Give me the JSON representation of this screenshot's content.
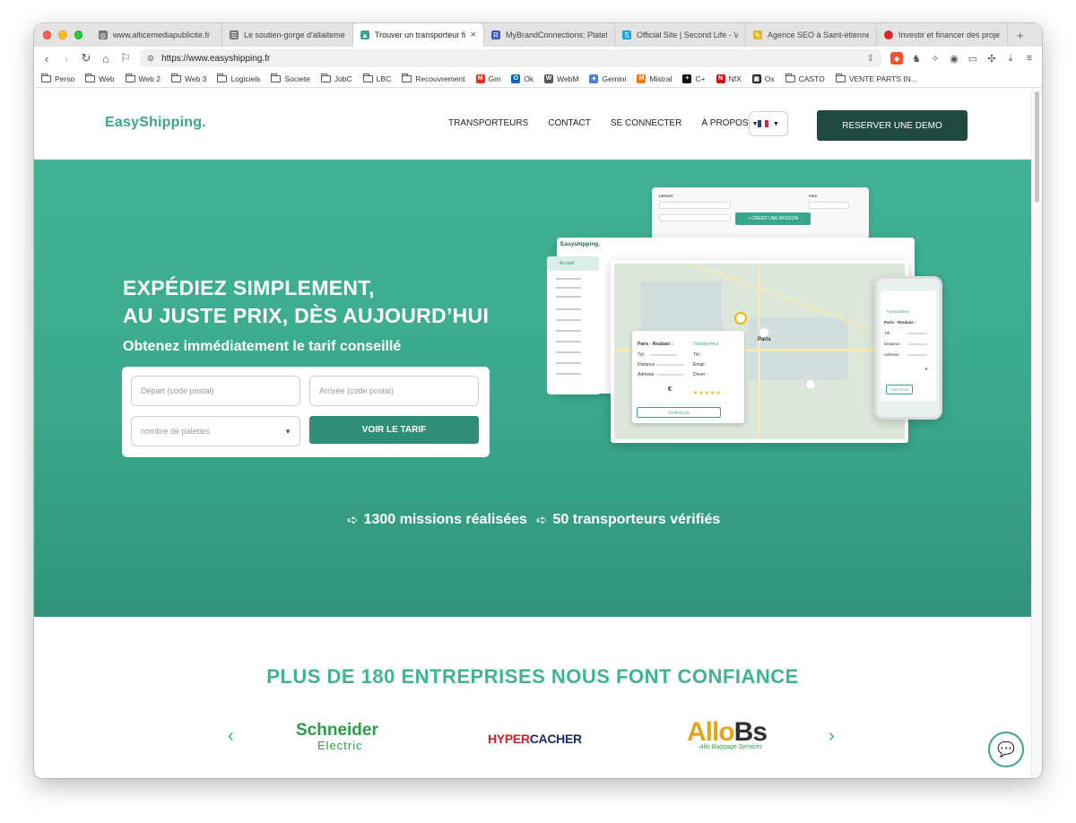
{
  "tabs": [
    {
      "title": "www.alticemediapublicite.fr",
      "icon_color": "#777777",
      "icon": "globe-icon",
      "active": false
    },
    {
      "title": "Le soutien-gorge d'allaitement",
      "icon_color": "#777777",
      "icon": "page-icon",
      "active": false
    },
    {
      "title": "Trouver un transporteur fi",
      "icon_color": "#3aa58d",
      "icon": "easyshipping-icon",
      "active": true
    },
    {
      "title": "MyBrandConnections: Platefo",
      "icon_color": "#3b5bc0",
      "icon": "rr-icon",
      "active": false
    },
    {
      "title": "Official Site | Second Life - Vi",
      "icon_color": "#19a3d9",
      "icon": "secondlife-icon",
      "active": false
    },
    {
      "title": "Agence SEO à Saint-étienne",
      "icon_color": "#e8b526",
      "icon": "seo-icon",
      "active": false
    },
    {
      "title": "Investir et financer des proje",
      "icon_color": "#d62828",
      "icon": "invest-icon",
      "active": false
    }
  ],
  "url": "https://www.easyshipping.fr",
  "bookmarks": [
    {
      "label": "Perso",
      "type": "folder"
    },
    {
      "label": "Web",
      "type": "folder"
    },
    {
      "label": "Web 2",
      "type": "folder"
    },
    {
      "label": "Web 3",
      "type": "folder"
    },
    {
      "label": "Logiciels",
      "type": "folder"
    },
    {
      "label": "Societe",
      "type": "folder"
    },
    {
      "label": "JobC",
      "type": "folder"
    },
    {
      "label": "LBC",
      "type": "folder"
    },
    {
      "label": "Recouvrement",
      "type": "folder"
    },
    {
      "label": "Gm",
      "type": "icon",
      "color": "#d93025",
      "glyph": "M"
    },
    {
      "label": "Ok",
      "type": "icon",
      "color": "#0a66c2",
      "glyph": "O"
    },
    {
      "label": "WebM",
      "type": "icon",
      "color": "#555555",
      "glyph": "W"
    },
    {
      "label": "Gemini",
      "type": "icon",
      "color": "#4a7bd8",
      "glyph": "✦"
    },
    {
      "label": "Mistral",
      "type": "icon",
      "color": "#f07a16",
      "glyph": "M"
    },
    {
      "label": "C+",
      "type": "icon",
      "color": "#111111",
      "glyph": "+"
    },
    {
      "label": "NfX",
      "type": "icon",
      "color": "#d80f16",
      "glyph": "N"
    },
    {
      "label": "Ox",
      "type": "icon",
      "color": "#222222",
      "glyph": "▣"
    },
    {
      "label": "CASTO",
      "type": "folder"
    },
    {
      "label": "VENTE PARTS IN...",
      "type": "folder"
    }
  ],
  "site": {
    "logo": "EasyShipping.",
    "nav": [
      "TRANSPORTEURS",
      "CONTACT",
      "SE CONNECTER",
      "À PROPOS"
    ],
    "demo_button": "RESERVER UNE DEMO",
    "hero_line1": "EXPÉDIEZ SIMPLEMENT,",
    "hero_line2": "AU JUSTE PRIX, DÈS AUJOURD’HUI",
    "hero_sub": "Obtenez immédiatement le tarif conseillé",
    "form": {
      "depart_placeholder": "Départ (code postal)",
      "arrivee_placeholder": "Arrivée (code postal)",
      "palettes_placeholder": "nombre de palettes",
      "submit": "VOIR LE TARIF"
    },
    "stat1": "1300 missions réalisées",
    "stat2": "50 transporteurs vérifiés",
    "mock": {
      "logo": "Easyshipping.",
      "accueil": "Accueil",
      "create_mission": "CRÉER UNE MISSION",
      "depart": "DÉPART",
      "prix": "PRIX",
      "route": "Paris - Roubaix :",
      "tel": "Tél :",
      "distance": "Distance :",
      "adresse": "Adresse :",
      "email": "Email :",
      "driver": "Driver :",
      "transporteur": "Transporteur",
      "voir_plus": "VOIR PLUS",
      "euro": "€",
      "city_map_label": "Paris"
    },
    "trust_title": "PLUS DE 180 ENTREPRISES NOUS FONT CONFIANCE",
    "logos": {
      "schneider_1": "Schneider",
      "schneider_2": "Electric",
      "hyper_1": "HYPER",
      "hyper_2": "CACHER",
      "allo_1": "Allo",
      "allo_2": "Bs",
      "allo_tag": "Allo Baggage Services"
    }
  },
  "colors": {
    "brand": "#3aa58d",
    "dark_button": "#1f4a40",
    "hero_bg": "#3ba88b"
  }
}
